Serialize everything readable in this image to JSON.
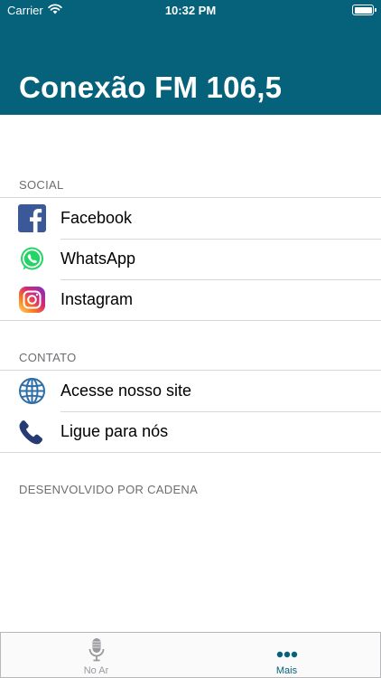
{
  "status_bar": {
    "carrier": "Carrier",
    "time": "10:32 PM"
  },
  "header": {
    "title": "Conexão FM 106,5",
    "background_color": "#05627a"
  },
  "sections": [
    {
      "title": "SOCIAL",
      "items": [
        {
          "label": "Facebook",
          "icon": "facebook-icon"
        },
        {
          "label": "WhatsApp",
          "icon": "whatsapp-icon"
        },
        {
          "label": "Instagram",
          "icon": "instagram-icon"
        }
      ]
    },
    {
      "title": "CONTATO",
      "items": [
        {
          "label": "Acesse nosso site",
          "icon": "globe-icon"
        },
        {
          "label": "Ligue para nós",
          "icon": "phone-icon"
        }
      ]
    }
  ],
  "footer_note": "DESENVOLVIDO POR CADENA",
  "tab_bar": {
    "tabs": [
      {
        "label": "No Ar",
        "icon": "microphone-icon",
        "selected": false
      },
      {
        "label": "Mais",
        "icon": "more-icon",
        "selected": true
      }
    ],
    "selected_color": "#05627a",
    "unselected_color": "#9a9a9e"
  }
}
